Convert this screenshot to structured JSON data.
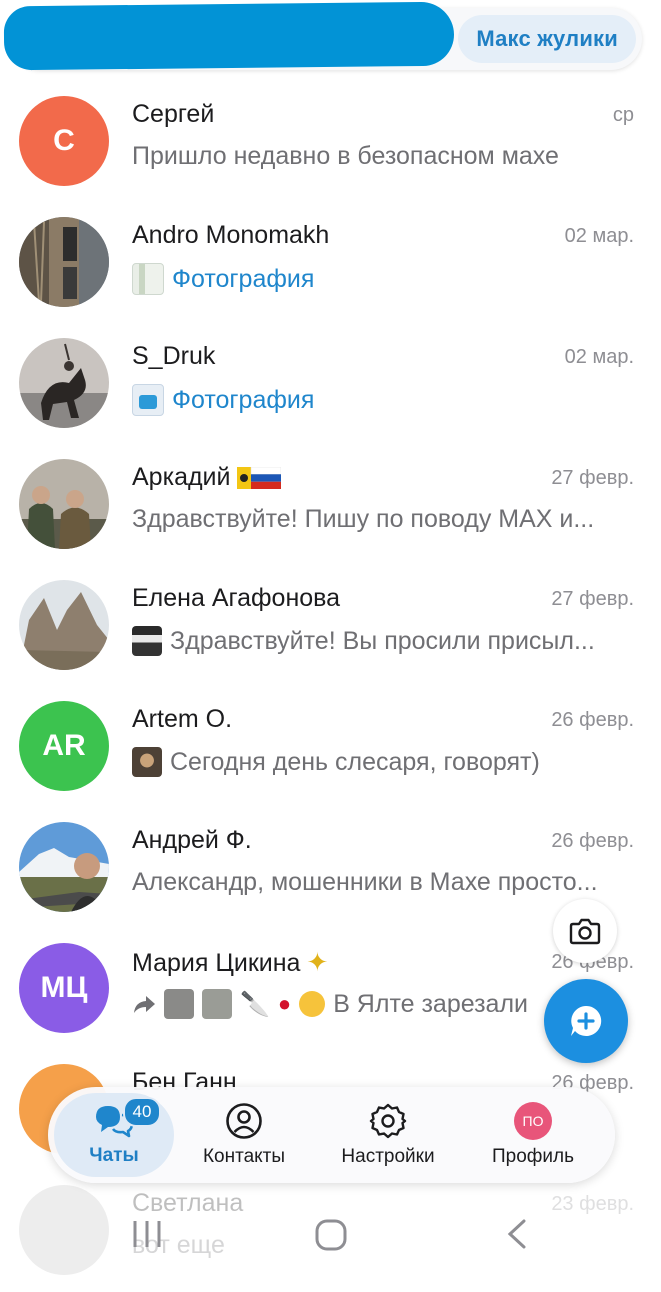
{
  "topbar": {
    "filter_label": "Макс жулики"
  },
  "chats": [
    {
      "name": "Сергей",
      "date": "ср",
      "preview": "Пришло недавно в безопасном махе",
      "avatar_initials": "С",
      "avatar_color": "#f26a4b"
    },
    {
      "name": "Andro Monomakh",
      "date": "02 мар.",
      "preview": "Фотография"
    },
    {
      "name": "S_Druk",
      "date": "02 мар.",
      "preview": "Фотография"
    },
    {
      "name": "Аркадий",
      "date": "27 февр.",
      "preview": "Здравствуйте!  Пишу по поводу MAX и..."
    },
    {
      "name": "Елена Агафонова",
      "date": "27 февр.",
      "preview": "Здравствуйте! Вы просили присыл..."
    },
    {
      "name": "Artem O.",
      "date": "26 февр.",
      "preview": "Сегодня день слесаря, говорят)",
      "avatar_initials": "AR",
      "avatar_color": "#3cc34f"
    },
    {
      "name": "Андрей Ф.",
      "date": "26 февр.",
      "preview": "Александр, мошенники в Махе просто..."
    },
    {
      "name": "Мария Цикина",
      "date": "26 февр.",
      "preview": "В Ялте зарезали",
      "avatar_initials": "МЦ",
      "avatar_color": "#8a5ce6"
    },
    {
      "name": "Бен Ганн",
      "date": "26 февр.",
      "avatar_color": "#f5a04a"
    },
    {
      "name": "Светлана",
      "date": "23 февр.",
      "preview": "вот еще"
    }
  ],
  "bottom_nav": {
    "chats_label": "Чаты",
    "chats_badge": "40",
    "contacts_label": "Контакты",
    "settings_label": "Настройки",
    "profile_label": "Профиль",
    "profile_initials": "ПО"
  },
  "colors": {
    "accent": "#1f86cc",
    "redaction": "#0293d6"
  },
  "icons": [
    "camera-icon",
    "compose-icon",
    "chats-icon",
    "contacts-icon",
    "settings-icon",
    "recents-icon",
    "home-icon",
    "back-icon",
    "forward-icon"
  ]
}
